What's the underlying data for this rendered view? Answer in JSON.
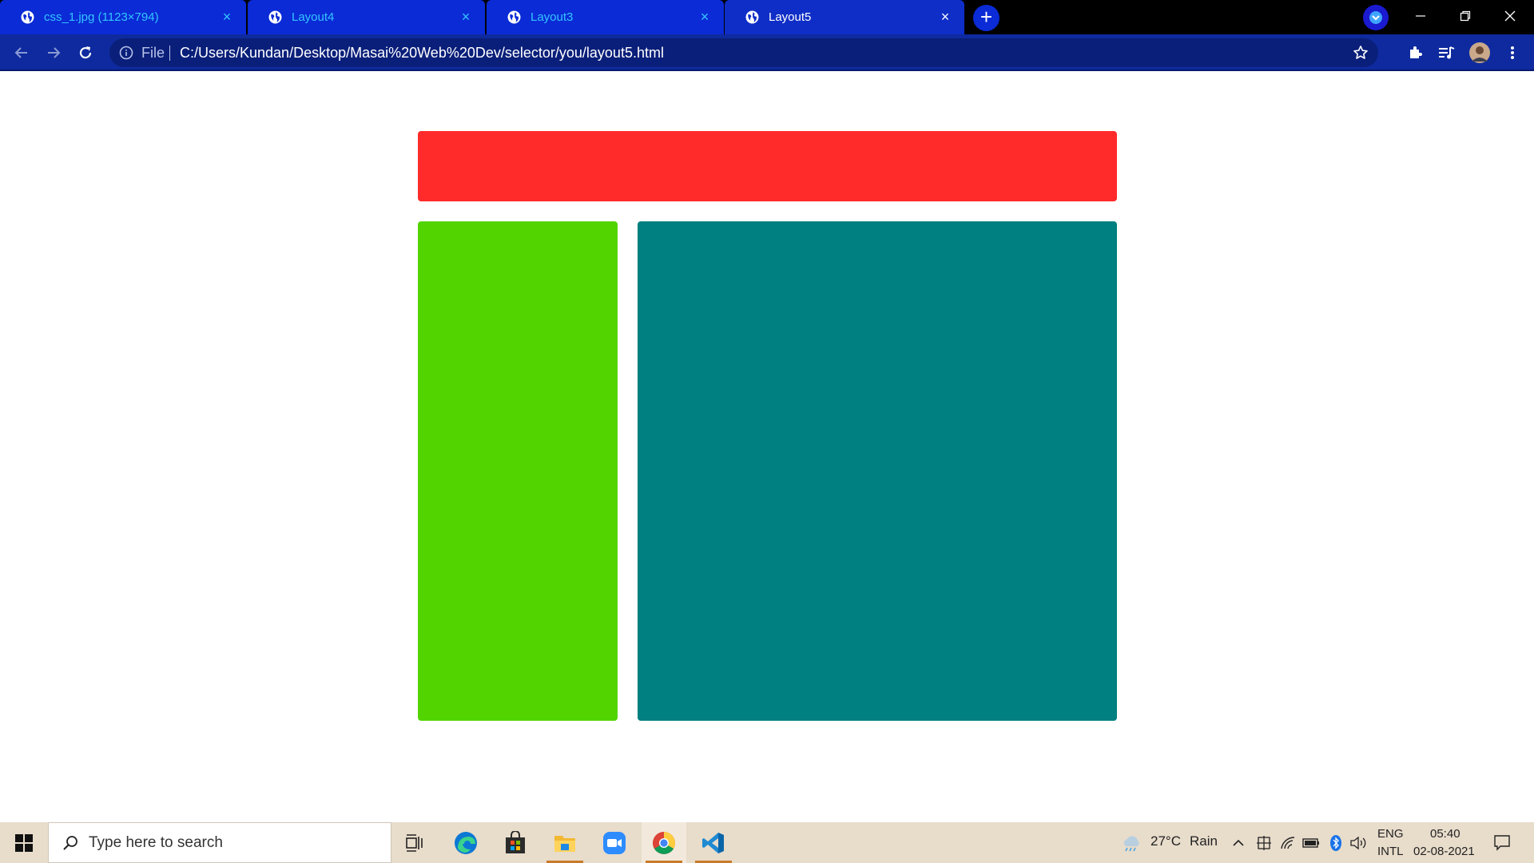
{
  "browser": {
    "tabs": [
      {
        "title": "css_1.jpg (1123×794)",
        "active": false
      },
      {
        "title": "Layout4",
        "active": false
      },
      {
        "title": "Layout3",
        "active": false
      },
      {
        "title": "Layout5",
        "active": true
      }
    ],
    "close_glyph": "×",
    "new_tab_glyph": "+",
    "address": {
      "scheme_label": "File",
      "url": "C:/Users/Kundan/Desktop/Masai%20Web%20Dev/selector/you/layout5.html"
    }
  },
  "page": {
    "boxes": {
      "header_color": "#ff2b2b",
      "sidebar_color": "#52d400",
      "main_color": "#008080"
    }
  },
  "taskbar": {
    "search_placeholder": "Type here to search",
    "weather": {
      "temp": "27°C",
      "condition": "Rain"
    },
    "language": {
      "line1": "ENG",
      "line2": "INTL"
    },
    "clock": {
      "time": "05:40",
      "date": "02-08-2021"
    },
    "apps": [
      "task-view",
      "edge",
      "store",
      "file-explorer",
      "zoom",
      "chrome",
      "vscode"
    ]
  },
  "icons": [
    "globe-icon",
    "close-icon",
    "plus-icon",
    "back-icon",
    "forward-icon",
    "reload-icon",
    "info-icon",
    "star-icon",
    "extensions-icon",
    "media-icon",
    "avatar",
    "menu-icon",
    "windows-icon",
    "search-icon"
  ]
}
